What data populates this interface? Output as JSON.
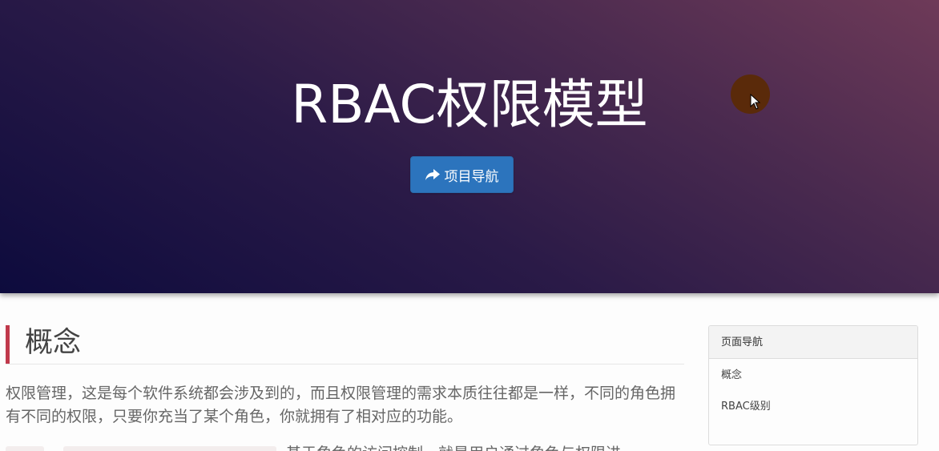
{
  "hero": {
    "title": "RBAC权限模型",
    "nav_button_label": "项目导航",
    "nav_button_icon": "share-arrow-icon",
    "gradient_colors": [
      "#0d0b3d",
      "#6e3a58"
    ]
  },
  "main": {
    "section_title": "概念",
    "paragraph": "权限管理，这是每个软件系统都会涉及到的，而且权限管理的需求本质往往都是一样，不同的角色拥有不同的权限，只要你充当了某个角色，你就拥有了相对应的功能。",
    "clipped_line_tail": "基于角色的访问控制，就是用户通过角色与权限进",
    "accent_color": "#c0394b"
  },
  "side_nav": {
    "header": "页面导航",
    "items": [
      {
        "label": "概念"
      },
      {
        "label": "RBAC级别"
      }
    ]
  },
  "colors": {
    "button": "#2c74bd",
    "cursor_highlight": "#5a2a0a"
  }
}
